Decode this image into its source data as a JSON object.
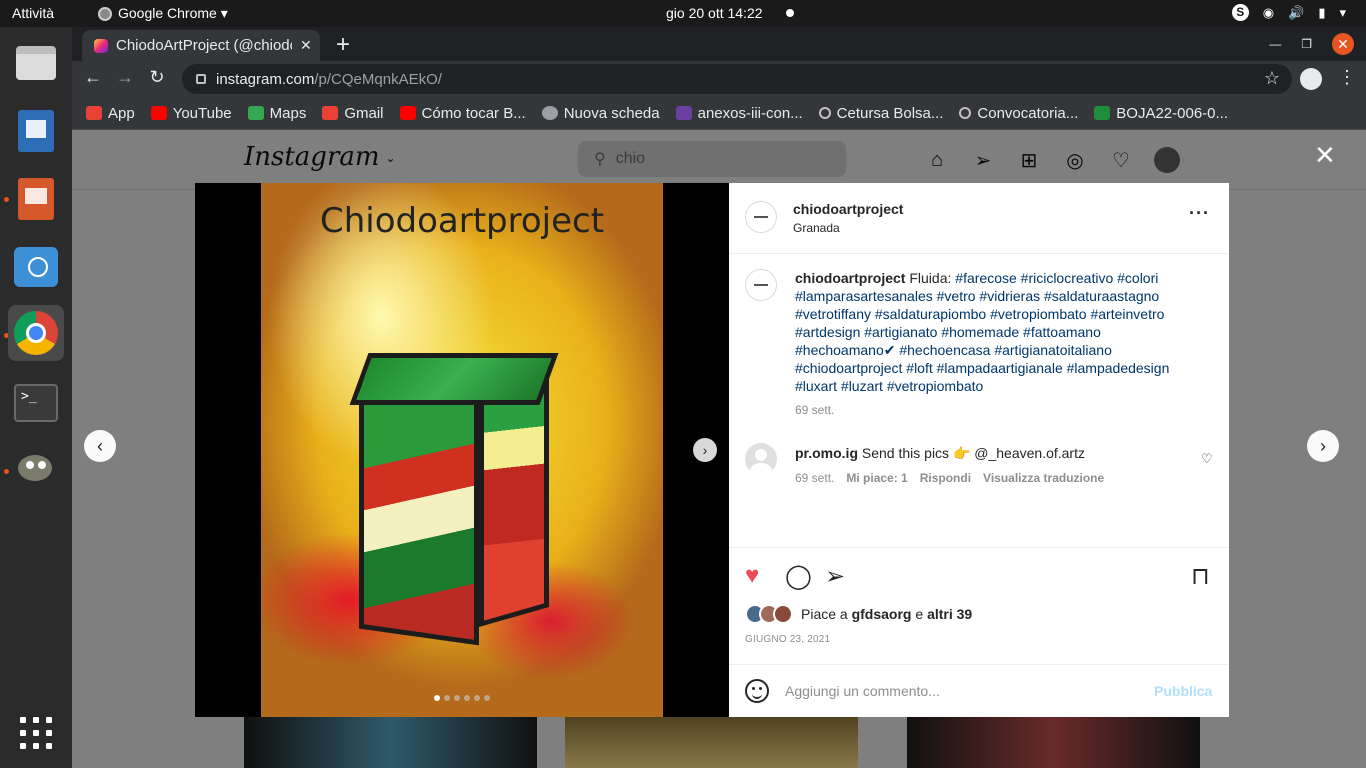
{
  "topbar": {
    "activities": "Attività",
    "app_name": "Google Chrome ▾",
    "clock": "gio 20 ott  14:22",
    "skype_badge": "S",
    "icons": [
      "wifi-icon",
      "volume-icon",
      "battery-icon",
      "power-icon"
    ]
  },
  "dock": {
    "items": [
      "files",
      "libreoffice-writer",
      "libreoffice-impress",
      "software-store",
      "google-chrome",
      "terminal",
      "gimp"
    ],
    "terminal_prompt": ">_"
  },
  "browser": {
    "tab_title": "ChiodoArtProject (@chiodoartproject)",
    "url_host": "instagram.com",
    "url_path": "/p/CQeMqnkAEkO/",
    "bookmarks": [
      "App",
      "YouTube",
      "Maps",
      "Gmail",
      "Cómo tocar B...",
      "Nuova scheda",
      "anexos-iii-con...",
      "Cetursa Bolsa...",
      "Convocatoria...",
      "BOJA22-006-0..."
    ],
    "bookmark_colors": [
      "#ea4335",
      "#ff0000",
      "#34a853",
      "#ea4335",
      "#ff0000",
      "#9aa0a6",
      "#6b3fa0",
      "#c0c0c0",
      "#c0c0c0",
      "#1e8e3e"
    ]
  },
  "instagram": {
    "logo": "Instagram",
    "search_value": "chio",
    "post": {
      "photo_title": "Chiodoartproject",
      "username": "chiodoartproject",
      "location": "Granada",
      "caption_lead": "Fluida:",
      "hashtags": "#farecose #riciclocreativo #colori #lamparasartesanales #vetro #vidrieras #saldaturaastagno #vetrotiffany #saldaturapiombo #vetropiombato #arteinvetro #artdesign #artigianato #homemade #fattoamano #hechoamano✔ #hechoencasa #artigianatoitaliano #chiodoartproject #loft #lampadaartigianale #lampadedesign #luxart #luzart #vetropiombato",
      "caption_time": "69 sett.",
      "comment": {
        "user": "pr.omo.ig",
        "text": "Send this pics 👉 @_heaven.of.artz",
        "time": "69 sett.",
        "likes": "Mi piace: 1",
        "reply": "Rispondi",
        "translate": "Visualizza traduzione"
      },
      "liked_by_prefix": "Piace a",
      "liked_by_user": "gfdsaorg",
      "liked_by_conj": "e",
      "liked_by_others": "altri 39",
      "date": "GIUGNO 23, 2021",
      "comment_placeholder": "Aggiungi un commento...",
      "publish": "Pubblica",
      "slide_count": 6,
      "active_slide": 0
    }
  }
}
